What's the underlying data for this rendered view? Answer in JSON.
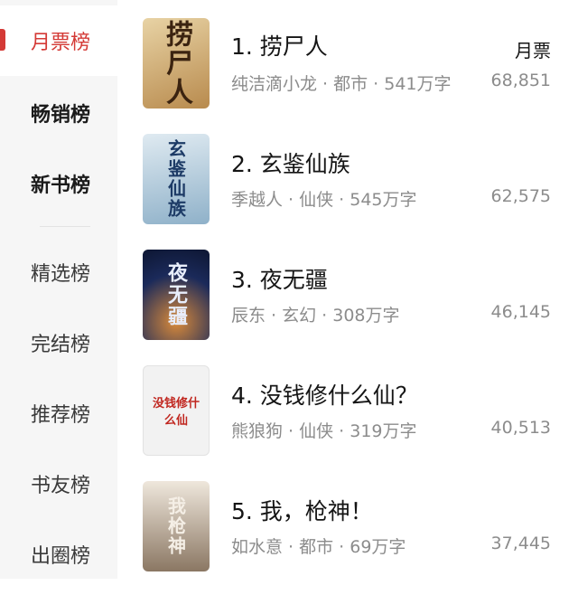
{
  "sidebar": {
    "items": [
      {
        "label": "月票榜"
      },
      {
        "label": "畅销榜"
      },
      {
        "label": "新书榜"
      },
      {
        "label": "精选榜"
      },
      {
        "label": "完结榜"
      },
      {
        "label": "推荐榜"
      },
      {
        "label": "书友榜"
      },
      {
        "label": "出圈榜"
      }
    ]
  },
  "list": {
    "metric_header": "月票",
    "books": [
      {
        "rank_title": "1. 捞尸人",
        "meta": "纯洁滴小龙 · 都市 · 541万字",
        "tickets": "68,851",
        "cover_text": "捞尸人",
        "cover_color": "#c9a46b"
      },
      {
        "rank_title": "2. 玄鉴仙族",
        "meta": "季越人 · 仙侠 · 545万字",
        "tickets": "62,575",
        "cover_text": "玄鉴仙族",
        "cover_color": "#a9c6d8"
      },
      {
        "rank_title": "3. 夜无疆",
        "meta": "辰东 · 玄幻 · 308万字",
        "tickets": "46,145",
        "cover_text": "夜无疆",
        "cover_color": "#14244a"
      },
      {
        "rank_title": "4. 没钱修什么仙？",
        "meta": "熊狼狗 · 仙侠 · 319万字",
        "tickets": "40,513",
        "cover_text": "没钱修什么仙",
        "cover_color": "#f1f1f1"
      },
      {
        "rank_title": "5. 我，枪神！",
        "meta": "如水意 · 都市 · 69万字",
        "tickets": "37,445",
        "cover_text": "我枪神",
        "cover_color": "#b7a590"
      }
    ]
  },
  "colors": {
    "accent": "#d43a36",
    "sidebar_bg": "#f6f6f6",
    "meta_gray": "#8c8c8c"
  }
}
